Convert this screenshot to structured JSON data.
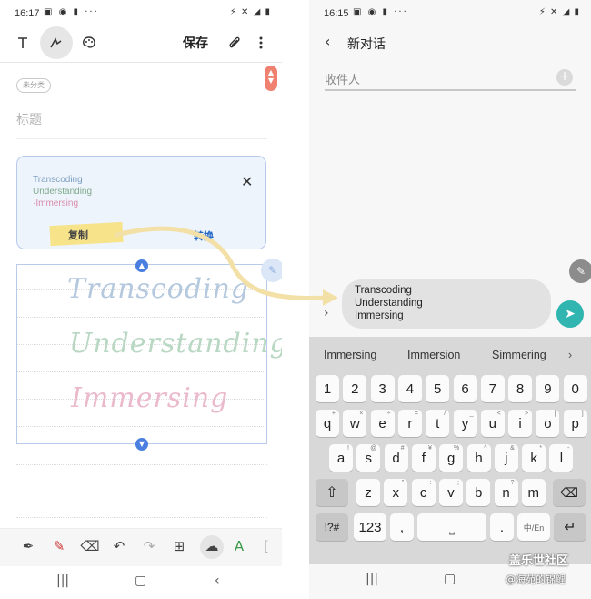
{
  "left": {
    "status": {
      "time": "16:17",
      "icons": "▣ ◉ ▮ ···",
      "right_icons": "⚡ ✕ ◢ ▮"
    },
    "toolbar": {
      "save_label": "保存"
    },
    "category": "未分类",
    "title_placeholder": "标题",
    "card": {
      "line1": "Transcoding",
      "line2": "Understanding",
      "line3": "·Immersing",
      "copy_label": "复制",
      "convert_label": "转换"
    },
    "handwriting": [
      "Transcoding",
      "Understanding",
      "Immersing"
    ]
  },
  "right": {
    "status": {
      "time": "16:15",
      "icons": "▣ ◉ ▮ ···",
      "right_icons": "⚡ ✕ ◢ ▮"
    },
    "header": {
      "title": "新对话"
    },
    "recipient_placeholder": "收件人",
    "composer_lines": [
      "Transcoding",
      "Understanding",
      "Immersing"
    ],
    "suggestions": [
      "Immersing",
      "Immersion",
      "Simmering"
    ],
    "keyboard": {
      "row1": [
        "1",
        "2",
        "3",
        "4",
        "5",
        "6",
        "7",
        "8",
        "9",
        "0"
      ],
      "row2": [
        [
          "q",
          "+"
        ],
        [
          "w",
          "×"
        ],
        [
          "e",
          "÷"
        ],
        [
          "r",
          "="
        ],
        [
          "t",
          "/"
        ],
        [
          "y",
          "_"
        ],
        [
          "u",
          "<"
        ],
        [
          "i",
          ">"
        ],
        [
          "o",
          "["
        ],
        [
          "p",
          "]"
        ]
      ],
      "row3": [
        [
          "a",
          "!"
        ],
        [
          "s",
          "@"
        ],
        [
          "d",
          "#"
        ],
        [
          "f",
          "¥"
        ],
        [
          "g",
          "%"
        ],
        [
          "h",
          "^"
        ],
        [
          "j",
          "&"
        ],
        [
          "k",
          "*"
        ],
        [
          "l",
          "-"
        ]
      ],
      "row4": [
        [
          "z",
          "'"
        ],
        [
          "x",
          "\""
        ],
        [
          "c",
          ":"
        ],
        [
          "v",
          ";"
        ],
        [
          "b",
          ","
        ],
        [
          "n",
          "?"
        ],
        [
          "m",
          ""
        ]
      ],
      "symbols_label": "!?#",
      "numbers_label": "123",
      "comma": ",",
      "period": ".",
      "lang_label": "中/En"
    }
  },
  "watermark": {
    "line1": "盖乐世社区",
    "line2": "@海苑的锦鲤"
  },
  "colors": {
    "accent_blue": "#4a7fe0",
    "send_teal": "#30b5b0",
    "highlight_yellow": "#f6e38a"
  }
}
